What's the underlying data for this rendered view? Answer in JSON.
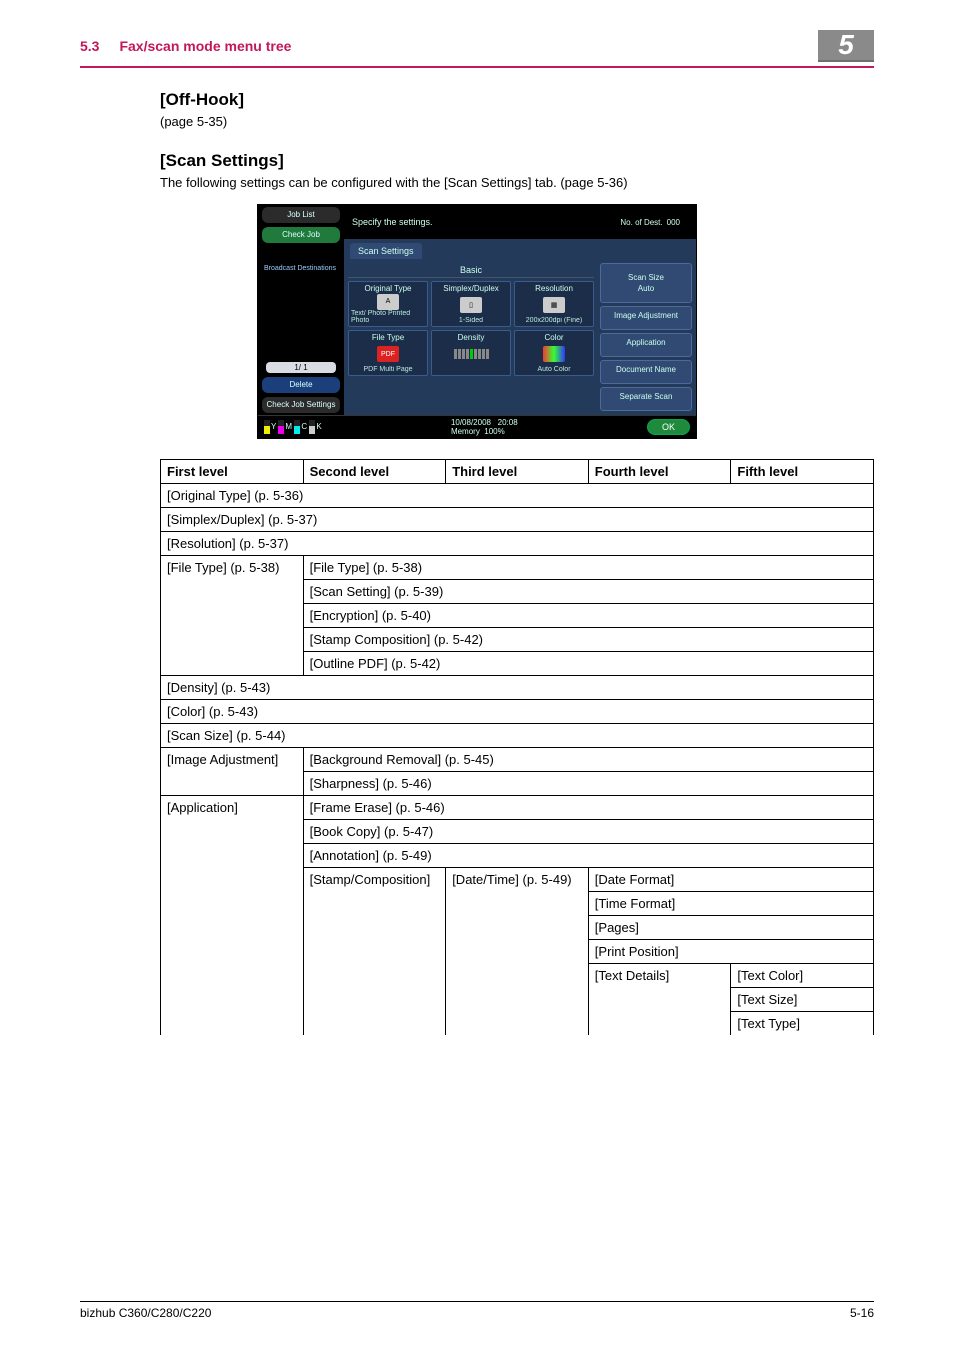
{
  "header": {
    "section_number": "5.3",
    "section_title": "Fax/scan mode menu tree",
    "chapter_number": "5"
  },
  "sections": {
    "off_hook": {
      "heading": "[Off-Hook]",
      "page_ref": "(page 5-35)"
    },
    "scan_settings": {
      "heading": "[Scan Settings]",
      "intro": "The following settings can be configured with the [Scan Settings] tab. (page 5-36)"
    }
  },
  "device_screen": {
    "top": {
      "prompt": "Specify the settings.",
      "dest_label": "No. of Dest.",
      "dest_count": "000"
    },
    "side": {
      "job_list": "Job List",
      "check_job": "Check Job",
      "broadcast": "Broadcast Destinations",
      "pager": "1/  1",
      "delete": "Delete",
      "check_settings": "Check Job Settings"
    },
    "tab": "Scan Settings",
    "group_title": "Basic",
    "cells": {
      "original_type": {
        "title": "Original Type",
        "sub": "Text/ Photo Printed Photo"
      },
      "simplex": {
        "title": "Simplex/Duplex",
        "sub": "1-Sided"
      },
      "resolution": {
        "title": "Resolution",
        "sub": "200x200dpi (Fine)"
      },
      "file_type": {
        "title": "File Type",
        "sub": "PDF Multi Page",
        "icon": "PDF"
      },
      "density": {
        "title": "Density"
      },
      "color": {
        "title": "Color",
        "sub": "Auto Color"
      }
    },
    "right": {
      "scan_size": {
        "title": "Scan Size",
        "sub": "Auto"
      },
      "image_adjustment": "Image Adjustment",
      "application": "Application",
      "document_name": "Document Name",
      "separate_scan": "Separate Scan"
    },
    "footer": {
      "supplies": [
        "Y",
        "M",
        "C",
        "K"
      ],
      "date": "10/08/2008",
      "time": "20:08",
      "memory_label": "Memory",
      "memory_value": "100%",
      "ok": "OK"
    }
  },
  "table": {
    "headers": {
      "l1": "First level",
      "l2": "Second level",
      "l3": "Third level",
      "l4": "Fourth level",
      "l5": "Fifth level"
    },
    "rows": {
      "original_type": "[Original Type] (p. 5-36)",
      "simplex": "[Simplex/Duplex] (p. 5-37)",
      "resolution": "[Resolution] (p. 5-37)",
      "file_type_l1": "[File Type] (p. 5-38)",
      "file_type_l2a": "[File Type] (p. 5-38)",
      "file_type_l2b": "[Scan Setting] (p. 5-39)",
      "file_type_l2c": "[Encryption] (p. 5-40)",
      "file_type_l2d": "[Stamp Composition] (p. 5-42)",
      "file_type_l2e": "[Outline PDF] (p. 5-42)",
      "density": "[Density] (p. 5-43)",
      "color": "[Color] (p. 5-43)",
      "scan_size": "[Scan Size] (p. 5-44)",
      "image_adj_l1": "[Image Adjustment]",
      "image_adj_l2a": "[Background Removal] (p. 5-45)",
      "image_adj_l2b": "[Sharpness] (p. 5-46)",
      "application_l1": "[Application]",
      "application_l2a": "[Frame Erase] (p. 5-46)",
      "application_l2b": "[Book Copy] (p. 5-47)",
      "application_l2c": "[Annotation] (p. 5-49)",
      "stamp_l2": "[Stamp/Composition]",
      "stamp_l3": "[Date/Time] (p. 5-49)",
      "stamp_l4a": "[Date Format]",
      "stamp_l4b": "[Time Format]",
      "stamp_l4c": "[Pages]",
      "stamp_l4d": "[Print Position]",
      "stamp_l4e": "[Text Details]",
      "stamp_l5a": "[Text Color]",
      "stamp_l5b": "[Text Size]",
      "stamp_l5c": "[Text Type]"
    }
  },
  "footer": {
    "model": "bizhub C360/C280/C220",
    "page": "5-16"
  }
}
